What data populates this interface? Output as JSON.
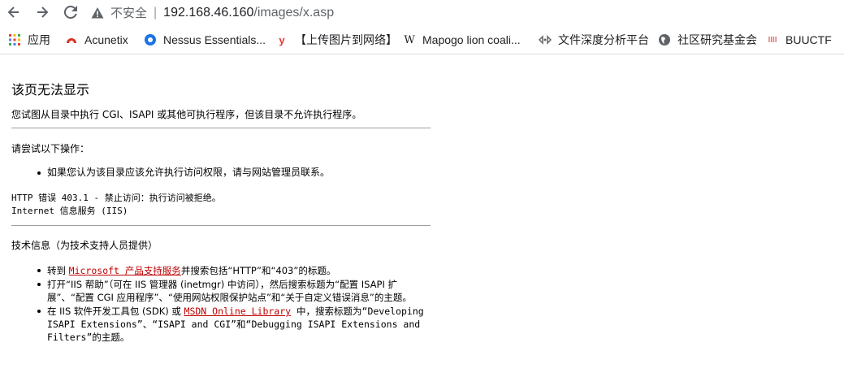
{
  "browser": {
    "insecure_label": "不安全",
    "separator": "|",
    "url_host": "192.168.46.160",
    "url_path": "/images/x.asp"
  },
  "bookmarks": [
    {
      "label": "应用",
      "icon": "apps-grid-icon",
      "color": "#ea4335"
    },
    {
      "label": "Acunetix",
      "icon": "acunetix-icon",
      "color": "#d93025"
    },
    {
      "label": "Nessus Essentials...",
      "icon": "nessus-icon",
      "color": "#1a73e8"
    },
    {
      "label": "【上传图片到网络】",
      "icon": "upload-y-icon",
      "color": "#e53935"
    },
    {
      "label": "Mapogo lion coali...",
      "icon": "wikipedia-w-icon",
      "color": "#202124"
    },
    {
      "label": "文件深度分析平台",
      "icon": "analysis-icon",
      "color": "#5f6368"
    },
    {
      "label": "社区研究基金会",
      "icon": "globe-icon",
      "color": "#5f6368"
    },
    {
      "label": "BUUCTF",
      "icon": "buuctf-icon",
      "color": "#e57373"
    }
  ],
  "page": {
    "title": "该页无法显示",
    "description": "您试图从目录中执行 CGI、ISAPI 或其他可执行程序，但该目录不允许执行程序。",
    "try_heading": "请尝试以下操作：",
    "try_items": [
      "如果您认为该目录应该允许执行访问权限，请与网站管理员联系。"
    ],
    "error_line1": "HTTP 错误 403.1 - 禁止访问：执行访问被拒绝。",
    "error_line2": "Internet 信息服务 (IIS)",
    "tech_heading": "技术信息（为技术支持人员提供）",
    "tech_item1_prefix": "转到 ",
    "tech_item1_link": "Microsoft 产品支持服务",
    "tech_item1_suffix": "并搜索包括“HTTP”和“403”的标题。",
    "tech_item2": "打开“IIS 帮助”（可在 IIS 管理器 (inetmgr) 中访问），然后搜索标题为“配置 ISAPI 扩展”、“配置 CGI 应用程序”、“使用网站权限保护站点”和“关于自定义错误消息”的主题。",
    "tech_item3_prefix": "在 IIS 软件开发工具包 (SDK) 或 ",
    "tech_item3_link": "MSDN Online Library",
    "tech_item3_suffix": " 中，搜索标题为“Developing ISAPI Extensions”、“ISAPI and CGI”和“Debugging ISAPI Extensions and Filters”的主题。"
  }
}
